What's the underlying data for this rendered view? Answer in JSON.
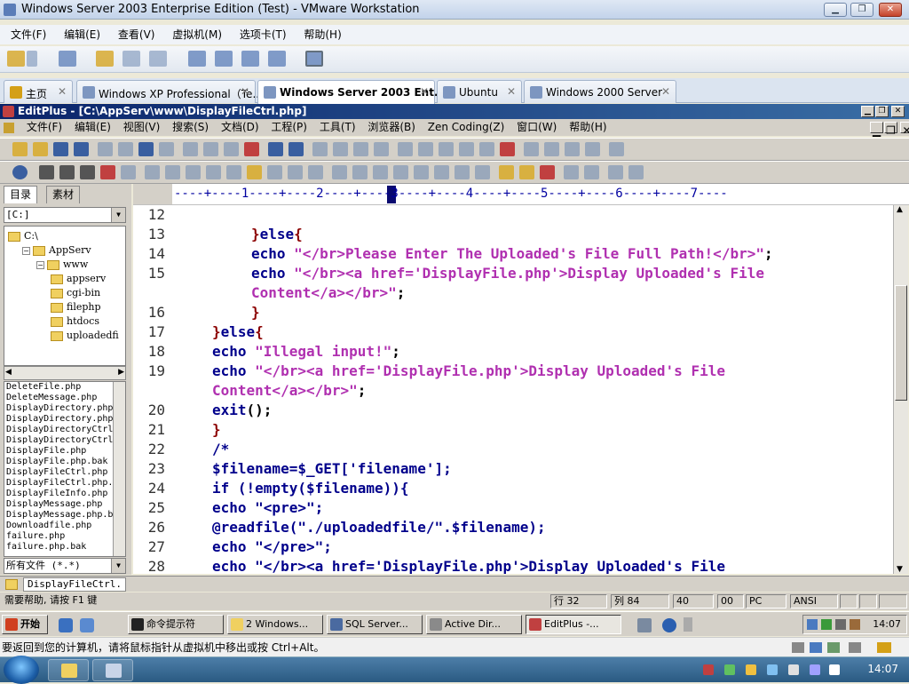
{
  "vmware": {
    "title": "Windows Server 2003 Enterprise Edition (Test) - VMware Workstation",
    "menu": [
      "文件(F)",
      "编辑(E)",
      "查看(V)",
      "虚拟机(M)",
      "选项卡(T)",
      "帮助(H)"
    ],
    "tabs": [
      {
        "label": "主页"
      },
      {
        "label": "Windows XP Professional（Te..."
      },
      {
        "label": "Windows Server 2003 Ent..."
      },
      {
        "label": "Ubuntu"
      },
      {
        "label": "Windows 2000 Server"
      }
    ],
    "close_glyph": "✕"
  },
  "editplus": {
    "title": "EditPlus - [C:\\AppServ\\www\\DisplayFileCtrl.php]",
    "menu": [
      "文件(F)",
      "编辑(E)",
      "视图(V)",
      "搜索(S)",
      "文档(D)",
      "工程(P)",
      "工具(T)",
      "浏览器(B)",
      "Zen Coding(Z)",
      "窗口(W)",
      "帮助(H)"
    ],
    "sidebar": {
      "tabs": [
        "目录",
        "素材"
      ],
      "drive": "[C:]",
      "tree": [
        {
          "label": "C:\\",
          "depth": 0,
          "toggle": ""
        },
        {
          "label": "AppServ",
          "depth": 1,
          "toggle": "−"
        },
        {
          "label": "www",
          "depth": 2,
          "toggle": "−"
        },
        {
          "label": "appserv",
          "depth": 3,
          "toggle": ""
        },
        {
          "label": "cgi-bin",
          "depth": 3,
          "toggle": ""
        },
        {
          "label": "filephp",
          "depth": 3,
          "toggle": ""
        },
        {
          "label": "htdocs",
          "depth": 3,
          "toggle": ""
        },
        {
          "label": "uploadedfi",
          "depth": 3,
          "toggle": ""
        }
      ],
      "files": [
        "DeleteFile.php",
        "DeleteMessage.php",
        "DisplayDirectory.php",
        "DisplayDirectory.php",
        "DisplayDirectoryCtrl",
        "DisplayDirectoryCtrl",
        "DisplayFile.php",
        "DisplayFile.php.bak",
        "DisplayFileCtrl.php",
        "DisplayFileCtrl.php.",
        "DisplayFileInfo.php",
        "DisplayMessage.php",
        "DisplayMessage.php.b",
        "Downloadfile.php",
        "failure.php",
        "failure.php.bak"
      ],
      "filter": "所有文件 (*.*)"
    },
    "ruler": "----+----1----+----2----+----3----+----4----+----5----+----6----+----7----",
    "code_lines": [
      {
        "n": "12",
        "indent": 0,
        "parts": []
      },
      {
        "n": "13",
        "indent": 3,
        "parts": [
          {
            "t": "}",
            "c": "br"
          },
          {
            "t": "else",
            "c": "kw"
          },
          {
            "t": "{",
            "c": "br"
          }
        ]
      },
      {
        "n": "14",
        "indent": 3,
        "parts": [
          {
            "t": "echo ",
            "c": "kw"
          },
          {
            "t": "\"</br>Please Enter The Uploaded's File Full Path!</br>\"",
            "c": "str"
          },
          {
            "t": ";",
            "c": ""
          }
        ]
      },
      {
        "n": "15",
        "indent": 3,
        "parts": [
          {
            "t": "echo ",
            "c": "kw"
          },
          {
            "t": "\"</br><a href='DisplayFile.php'>Display Uploaded's File",
            "c": "str"
          }
        ]
      },
      {
        "n": "",
        "indent": 3,
        "parts": [
          {
            "t": "Content</a></br>\"",
            "c": "str"
          },
          {
            "t": ";",
            "c": ""
          }
        ]
      },
      {
        "n": "16",
        "indent": 3,
        "parts": [
          {
            "t": "}",
            "c": "br"
          }
        ]
      },
      {
        "n": "17",
        "indent": 2,
        "parts": [
          {
            "t": "}",
            "c": "br"
          },
          {
            "t": "else",
            "c": "kw"
          },
          {
            "t": "{",
            "c": "br"
          }
        ]
      },
      {
        "n": "18",
        "indent": 2,
        "parts": [
          {
            "t": "echo ",
            "c": "kw"
          },
          {
            "t": "\"Illegal input!\"",
            "c": "str"
          },
          {
            "t": ";",
            "c": ""
          }
        ]
      },
      {
        "n": "19",
        "indent": 2,
        "parts": [
          {
            "t": "echo ",
            "c": "kw"
          },
          {
            "t": "\"</br><a href='DisplayFile.php'>Display Uploaded's File",
            "c": "str"
          }
        ]
      },
      {
        "n": "",
        "indent": 2,
        "parts": [
          {
            "t": "Content</a></br>\"",
            "c": "str"
          },
          {
            "t": ";",
            "c": ""
          }
        ]
      },
      {
        "n": "20",
        "indent": 2,
        "parts": [
          {
            "t": "exit",
            "c": "kw"
          },
          {
            "t": "();",
            "c": ""
          }
        ]
      },
      {
        "n": "21",
        "indent": 2,
        "parts": [
          {
            "t": "}",
            "c": "br"
          }
        ]
      },
      {
        "n": "22",
        "indent": 2,
        "parts": [
          {
            "t": "/*",
            "c": "kw"
          }
        ]
      },
      {
        "n": "23",
        "indent": 2,
        "parts": [
          {
            "t": "$filename=$_GET['filename'];",
            "c": "kw"
          }
        ]
      },
      {
        "n": "24",
        "indent": 2,
        "parts": [
          {
            "t": "if (!empty($filename)){",
            "c": "kw"
          }
        ]
      },
      {
        "n": "25",
        "indent": 2,
        "parts": [
          {
            "t": "echo \"<pre>\";",
            "c": "kw"
          }
        ]
      },
      {
        "n": "26",
        "indent": 2,
        "parts": [
          {
            "t": "@readfile(\"./uploadedfile/\".$filename);",
            "c": "kw"
          }
        ]
      },
      {
        "n": "27",
        "indent": 2,
        "parts": [
          {
            "t": "echo \"</pre>\";",
            "c": "kw"
          }
        ]
      },
      {
        "n": "28",
        "indent": 2,
        "parts": [
          {
            "t": "echo \"</br><a href='DisplayFile.php'>Display Uploaded's File",
            "c": "kw"
          }
        ]
      }
    ],
    "doc_tab": "DisplayFileCtrl.",
    "status": {
      "help": "需要帮助, 请按 F1 键",
      "line": "行 32",
      "col": "列 84",
      "v1": "40",
      "v2": "00",
      "mode": "PC",
      "encoding": "ANSI"
    }
  },
  "guest_taskbar": {
    "start": "开始",
    "buttons": [
      "命令提示符",
      "2 Windows...",
      "SQL Server...",
      "Active Dir...",
      "EditPlus -..."
    ],
    "clock": "14:07"
  },
  "host": {
    "hint": "要返回到您的计算机，请将鼠标指针从虚拟机中移出或按 Ctrl+Alt。",
    "clock": "14:07"
  }
}
